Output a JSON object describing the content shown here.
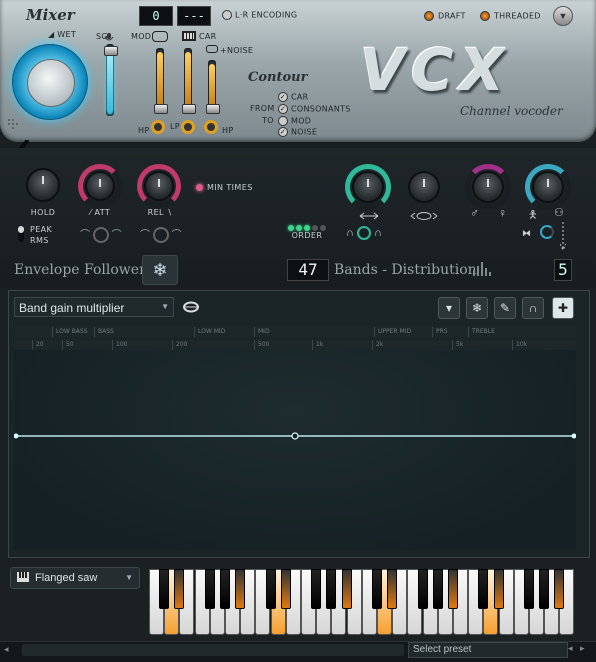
{
  "header": {
    "mixer_title": "Mixer",
    "wet_label": "WET",
    "sg_label": "SG",
    "mod_label": "MOD",
    "car_label": "CAR",
    "lcd_left": "0",
    "lcd_right": "---",
    "lr_encoding": "L·R ENCODING",
    "draft_label": "DRAFT",
    "threaded_label": "THREADED",
    "noise_label": "+NOISE",
    "hp_label": "HP",
    "lp_label": "LP",
    "hp2_label": "HP",
    "contour_title": "Contour",
    "from_label": "FROM",
    "to_label": "TO",
    "contour_options": [
      "CAR",
      "CONSONANTS",
      "MOD",
      "NOISE"
    ],
    "logo_text": "VCX",
    "subtitle": "Channel vocoder"
  },
  "envelope": {
    "hold_label": "HOLD",
    "att_label": "ATT",
    "rel_label": "REL",
    "min_times_label": "MIN TIMES",
    "peak_label": "PEAK",
    "rms_label": "RMS",
    "section_title": "Envelope Follower"
  },
  "bands": {
    "order_label": "ORDER",
    "lcd_value": "47",
    "section_title": "Bands - Distribution",
    "count_value": "5"
  },
  "editor": {
    "dropdown_value": "Band gain multiplier",
    "range_labels": [
      "LOW BASS",
      "BASS",
      "LOW MID",
      "MID",
      "UPPER MID",
      "PRS",
      "TREBLE"
    ],
    "freq_labels": [
      "20",
      "50",
      "100",
      "200",
      "500",
      "1k",
      "2k",
      "5k",
      "10k"
    ]
  },
  "keyboard": {
    "instrument": "Flanged saw"
  },
  "footer": {
    "preset_placeholder": "Select preset"
  },
  "colors": {
    "accent_cyan": "#4fd8f0",
    "accent_teal": "#2fb89a",
    "accent_pink": "#c03a6a",
    "led_orange": "#f0a040"
  }
}
